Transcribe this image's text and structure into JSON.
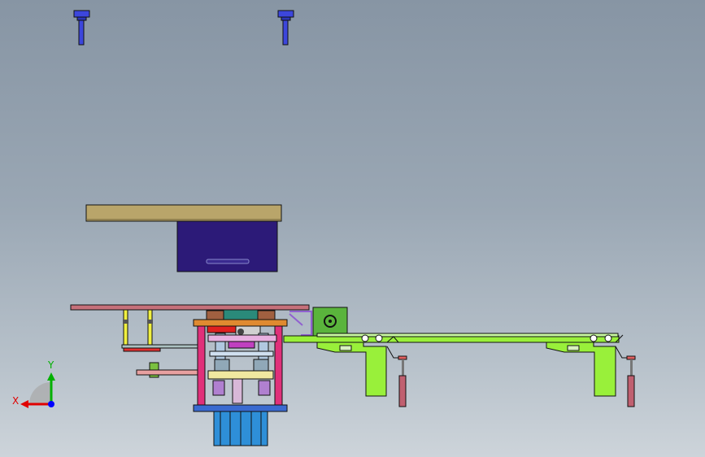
{
  "viewport": {
    "background_top": "#8795a4",
    "background_bottom": "#cdd4da"
  },
  "colors": {
    "bolt": "#3c46dc",
    "table_top": "#b9a56a",
    "cabinet": "#2c1a78",
    "frame_rail": "#c6707a",
    "pillar": "#e0307a",
    "conveyor": "#99f03a",
    "motor_box": "#5ab43c",
    "base_block": "#2e8fd8",
    "outline": "#111111",
    "axis_x": "#e00000",
    "axis_y": "#00b000",
    "axis_z": "#0000ff"
  },
  "icons": {
    "view_triad": "coordinate-triad-icon"
  },
  "triad": {
    "x_label": "X",
    "y_label": "Y"
  }
}
